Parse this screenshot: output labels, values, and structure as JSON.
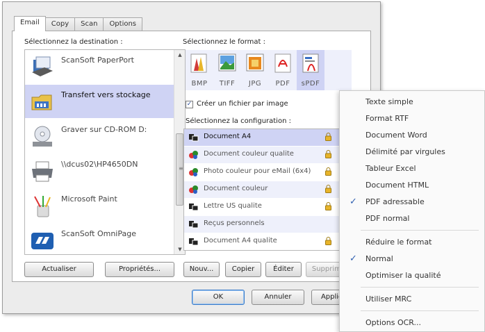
{
  "tabs": [
    {
      "label": "Email",
      "active": true
    },
    {
      "label": "Copy",
      "active": false
    },
    {
      "label": "Scan",
      "active": false
    },
    {
      "label": "Options",
      "active": false
    }
  ],
  "destination": {
    "heading": "Sélectionnez la destination :",
    "items": [
      {
        "label": "ScanSoft PaperPort",
        "icon": "paperport-icon",
        "selected": false
      },
      {
        "label": "Transfert vers stockage",
        "icon": "storage-folder-icon",
        "selected": true
      },
      {
        "label": "Graver sur CD-ROM D:",
        "icon": "cd-drive-icon",
        "selected": false
      },
      {
        "label": "\\\\dcus02\\HP4650DN",
        "icon": "printer-icon",
        "selected": false
      },
      {
        "label": "Microsoft Paint",
        "icon": "paint-icon",
        "selected": false
      },
      {
        "label": "ScanSoft OmniPage",
        "icon": "omnipage-icon",
        "selected": false
      }
    ],
    "buttons": {
      "refresh": "Actualiser",
      "properties": "Propriétés..."
    }
  },
  "format": {
    "heading": "Sélectionnez le format :",
    "items": [
      {
        "label": "BMP",
        "icon": "bmp-icon",
        "selected": false
      },
      {
        "label": "TIFF",
        "icon": "tiff-icon",
        "selected": false
      },
      {
        "label": "JPG",
        "icon": "jpg-icon",
        "selected": false
      },
      {
        "label": "PDF",
        "icon": "pdf-icon",
        "selected": false
      },
      {
        "label": "sPDF",
        "icon": "spdf-icon",
        "selected": true
      }
    ],
    "checkbox_label": "Créer un fichier par image",
    "checkbox_checked": true
  },
  "configuration": {
    "heading": "Sélectionnez la configuration :",
    "items": [
      {
        "label": "Document A4",
        "selected": true,
        "locked": true
      },
      {
        "label": "Document couleur qualite",
        "selected": false,
        "locked": true
      },
      {
        "label": "Photo couleur pour eMail (6x4)",
        "selected": false,
        "locked": true
      },
      {
        "label": "Document couleur",
        "selected": false,
        "locked": true
      },
      {
        "label": "Lettre US qualite",
        "selected": false,
        "locked": true
      },
      {
        "label": "Reçus personnels",
        "selected": false,
        "locked": false
      },
      {
        "label": "Document A4 qualite",
        "selected": false,
        "locked": true
      }
    ],
    "buttons": {
      "new": "Nouv...",
      "copy": "Copier",
      "edit": "Éditer",
      "delete": "Supprimer"
    }
  },
  "dialog_buttons": {
    "ok": "OK",
    "cancel": "Annuler",
    "apply": "Appliquer"
  },
  "context_menu": {
    "group1": [
      {
        "label": "Texte simple",
        "checked": false
      },
      {
        "label": "Format RTF",
        "checked": false
      },
      {
        "label": "Document Word",
        "checked": false
      },
      {
        "label": "Délimité par virgules",
        "checked": false
      },
      {
        "label": "Tableur Excel",
        "checked": false
      },
      {
        "label": "Document HTML",
        "checked": false
      },
      {
        "label": "PDF adressable",
        "checked": true
      },
      {
        "label": "PDF normal",
        "checked": false
      }
    ],
    "group2": [
      {
        "label": "Réduire le format",
        "checked": false
      },
      {
        "label": "Normal",
        "checked": true
      },
      {
        "label": "Optimiser la qualité",
        "checked": false
      }
    ],
    "group3": [
      {
        "label": "Utiliser MRC",
        "checked": false
      }
    ],
    "group4": [
      {
        "label": "Options OCR...",
        "checked": false
      }
    ],
    "check_glyph": "✓"
  },
  "colors": {
    "selection": "#cfd3f4",
    "accent": "#2f5fb0"
  }
}
